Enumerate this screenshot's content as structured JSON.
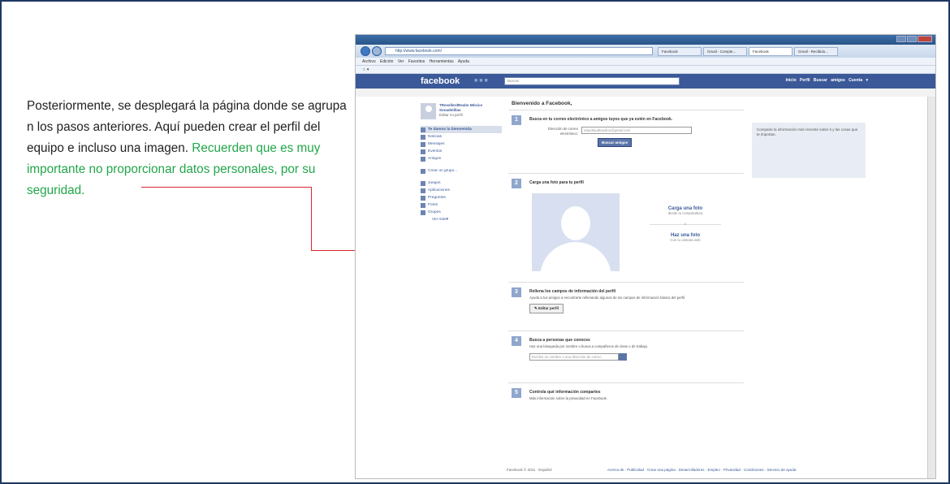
{
  "paragraph": {
    "text": "Posteriormente, se desplegará la página donde se agrupa n los pasos anteriores. Aquí pueden crear el perfil del equipo e incluso una imagen.",
    "highlight": "Recuerden que es muy importante no proporcionar datos personales, por su seguridad."
  },
  "colors": {
    "highlight": "#22a64a",
    "arrow": "#d9272e",
    "fb_blue": "#3b5998"
  },
  "browser": {
    "url": "http://www.facebook.com/",
    "tabs": [
      "Facebook",
      "Gmail - Compte...",
      "Facebook",
      "Gmail - Recibido..."
    ],
    "menu": "Archivo Edición Ver Favoritos Herramientas Ayuda"
  },
  "facebook": {
    "logo": "facebook",
    "search_placeholder": "Buscar",
    "nav": "Inicio Perfil Buscar amigos Cuenta ▾",
    "profile_name": "TResellerdRealm México Sonadetillas",
    "edit_profile": "Editar mi perfil",
    "menu": [
      "Te damos la bienvenida",
      "Noticias",
      "Mensajes",
      "Eventos",
      "Amigos",
      "Crear un grupo...",
      "Juegos",
      "Aplicaciones",
      "Preguntas",
      "Fotos",
      "Grupos",
      "Ver más▾"
    ],
    "welcome": "Bienvenido a Facebook,",
    "step1_title": "Busca en tu correo electrónico a amigos tuyos que ya estén en Facebook.",
    "step1_label": "Dirección de correo electrónico:",
    "step1_value": "tdaudtaudtaudino@gmail.com",
    "step1_button": "Buscar amigos",
    "step2_title": "Carga una foto para tu perfil",
    "upload_photo": "Carga una foto",
    "upload_sub": "desde tu computadora",
    "or": "o",
    "take_photo": "Haz una foto",
    "take_sub": "Con tu cámara web",
    "step3_title": "Rellena los campos de información del perfil",
    "step3_desc": "Ayuda a tus amigos a encontrarte rellenando algunos de los campos de información básica del perfil.",
    "step3_button": "✎ Editar perfil",
    "step4_title": "Busca a personas que conoces",
    "step4_desc": "Haz una búsqueda por nombre o busca a compañeros de clase o de trabajo.",
    "step4_placeholder": "Escribe un nombre o una dirección de correo",
    "step5_title": "Controla qué información compartes",
    "step5_desc": "Más información sobre la privacidad en Facebook.",
    "side_box": "Comparte la información más reciente sobre ti y las cosas que te importan.",
    "footer_left": "Facebook © 2011 · Español",
    "footer_right": "Acerca de · Publicidad · Crear una página · Desarrolladores · Empleo · Privacidad · Condiciones · Servicio de ayuda"
  }
}
